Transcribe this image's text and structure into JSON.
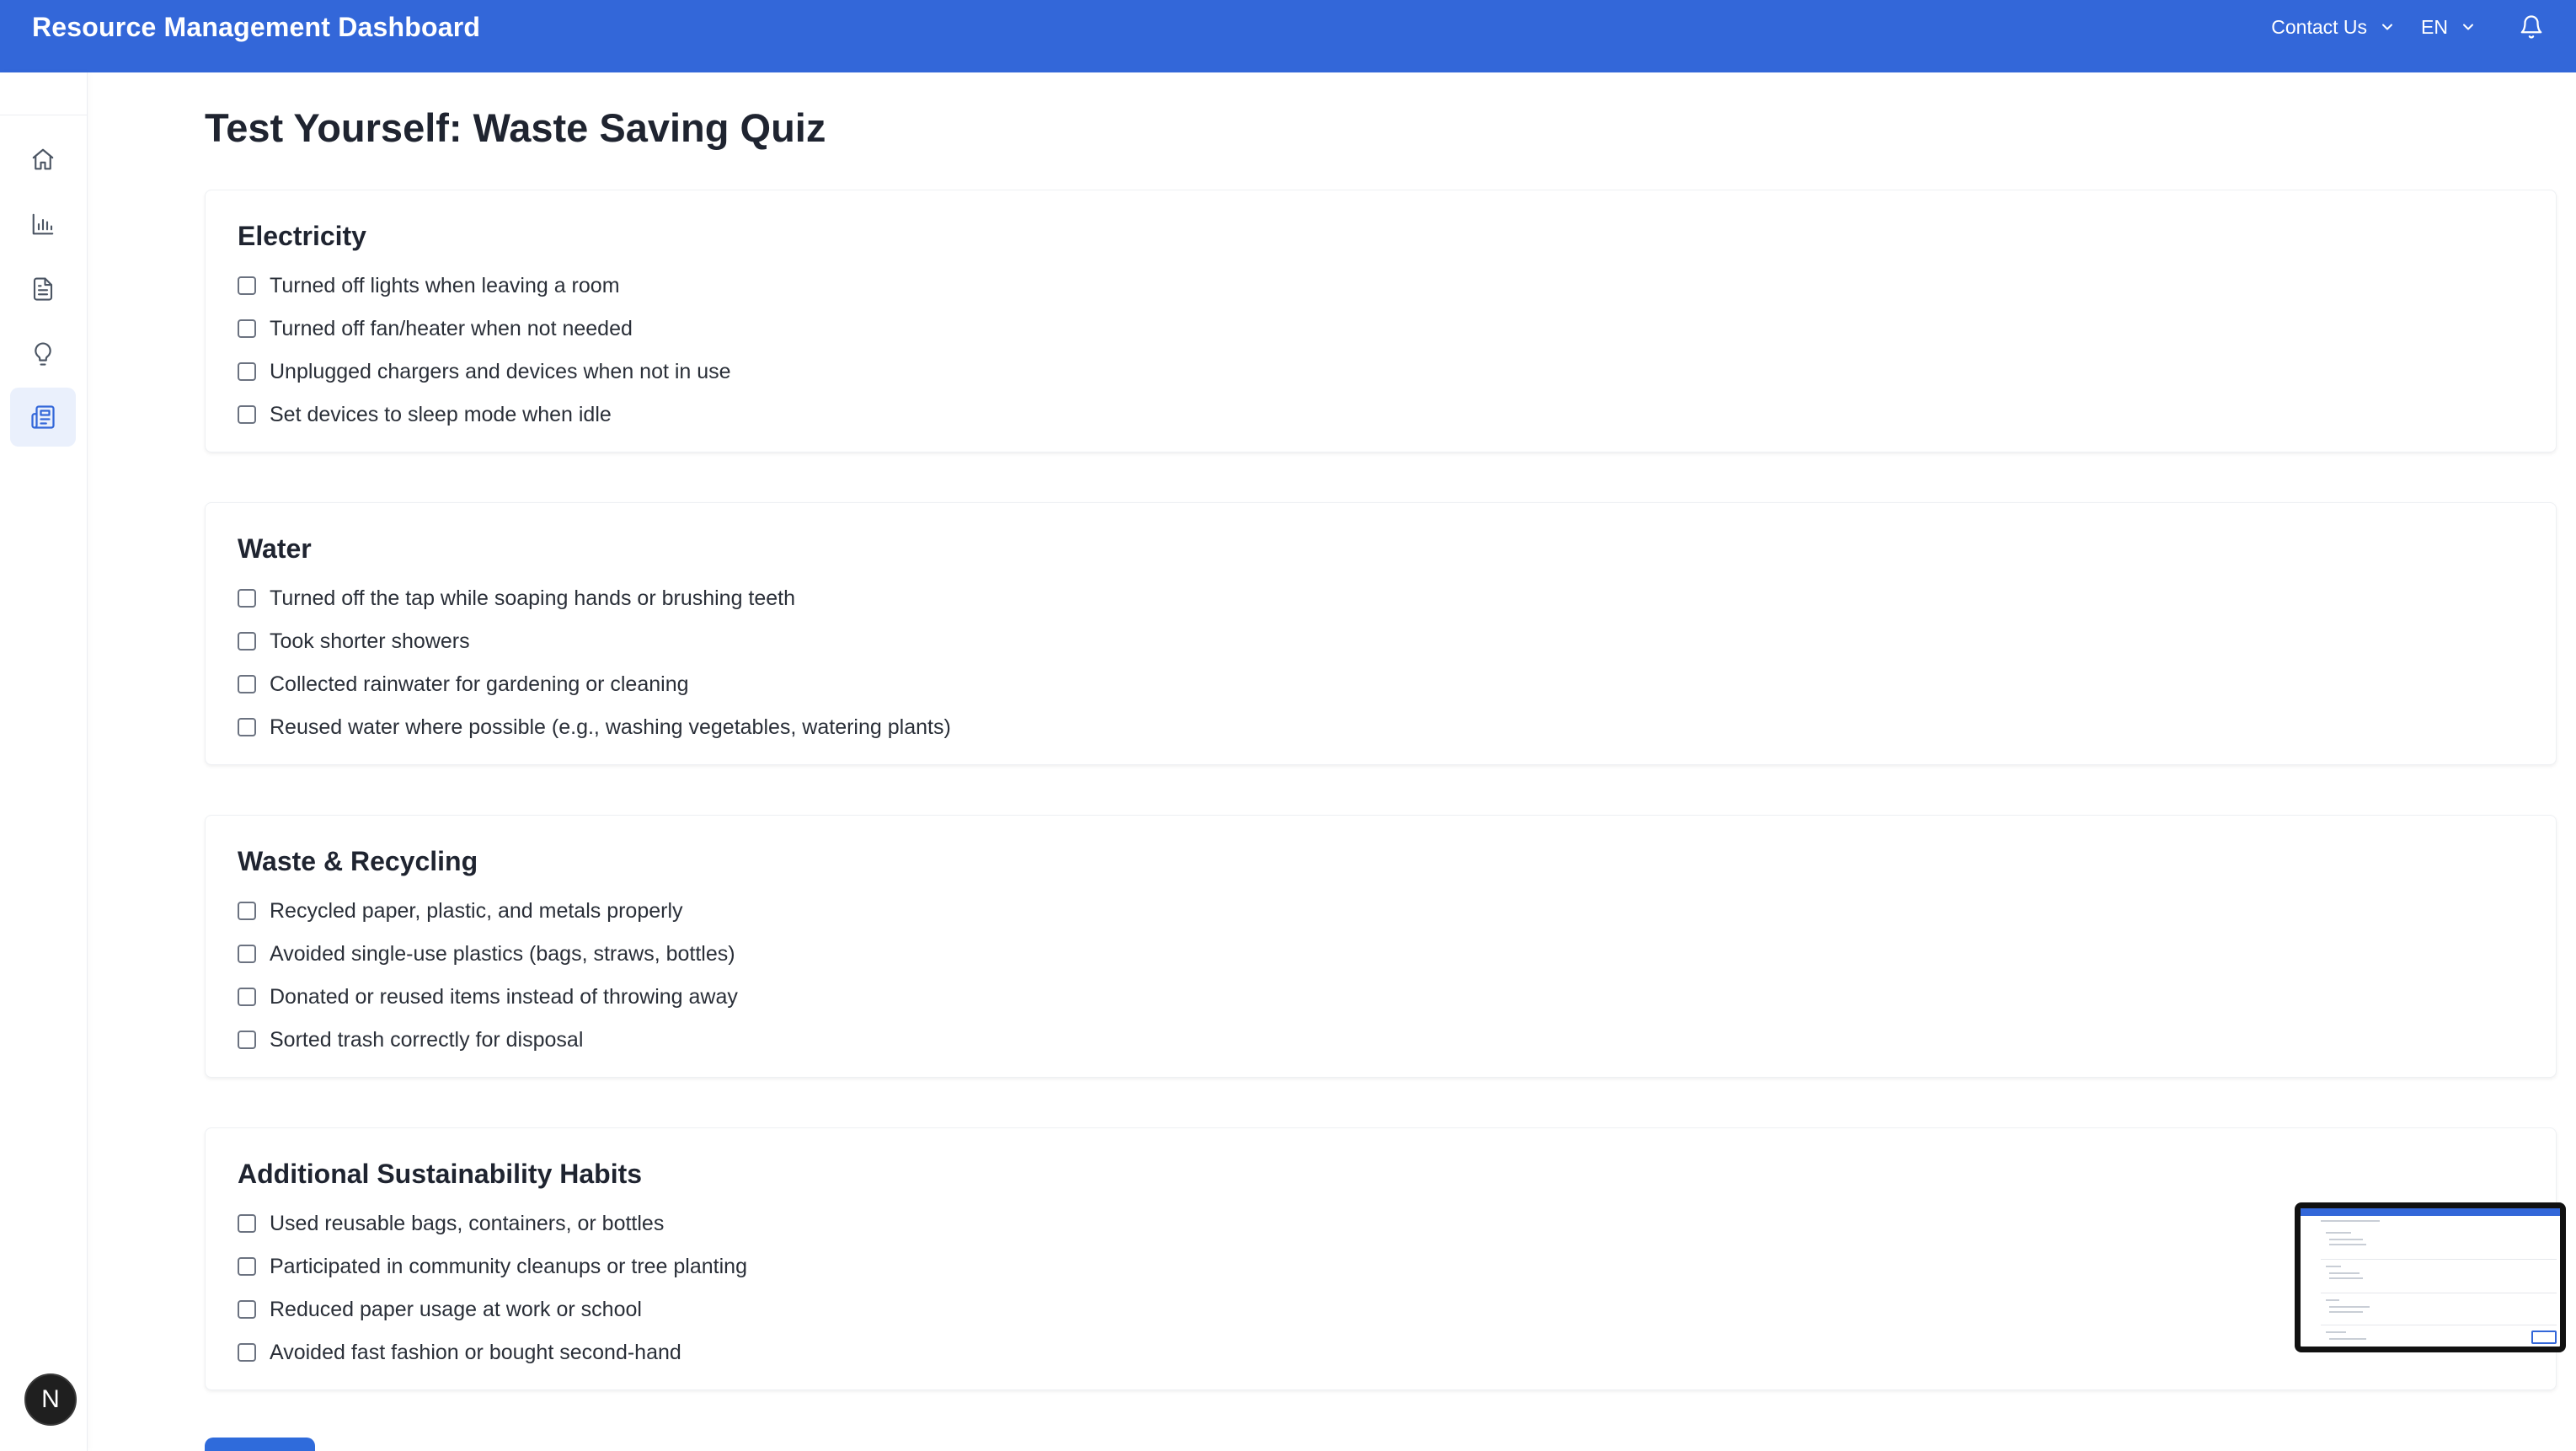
{
  "header": {
    "title": "Resource Management Dashboard",
    "contact_label": "Contact Us",
    "language_label": "EN"
  },
  "sidebar": {
    "items": [
      {
        "name": "home",
        "icon": "home-icon",
        "active": false
      },
      {
        "name": "analytics",
        "icon": "bar-chart-icon",
        "active": false
      },
      {
        "name": "reports",
        "icon": "document-icon",
        "active": false
      },
      {
        "name": "tips",
        "icon": "lightbulb-icon",
        "active": false
      },
      {
        "name": "quiz",
        "icon": "newspaper-icon",
        "active": true
      }
    ],
    "avatar_letter": "N"
  },
  "main": {
    "title": "Test Yourself: Waste Saving Quiz",
    "sections": [
      {
        "heading": "Electricity",
        "options": [
          "Turned off lights when leaving a room",
          "Turned off fan/heater when not needed",
          "Unplugged chargers and devices when not in use",
          "Set devices to sleep mode when idle"
        ]
      },
      {
        "heading": "Water",
        "options": [
          "Turned off the tap while soaping hands or brushing teeth",
          "Took shorter showers",
          "Collected rainwater for gardening or cleaning",
          "Reused water where possible (e.g., washing vegetables, watering plants)"
        ]
      },
      {
        "heading": "Waste & Recycling",
        "options": [
          "Recycled paper, plastic, and metals properly",
          "Avoided single-use plastics (bags, straws, bottles)",
          "Donated or reused items instead of throwing away",
          "Sorted trash correctly for disposal"
        ]
      },
      {
        "heading": "Additional Sustainability Habits",
        "options": [
          "Used reusable bags, containers, or bottles",
          "Participated in community cleanups or tree planting",
          "Reduced paper usage at work or school",
          "Avoided fast fashion or bought second-hand"
        ]
      }
    ]
  },
  "colors": {
    "accent": "#3367d9",
    "active_nav_bg": "#eaf0fc"
  }
}
